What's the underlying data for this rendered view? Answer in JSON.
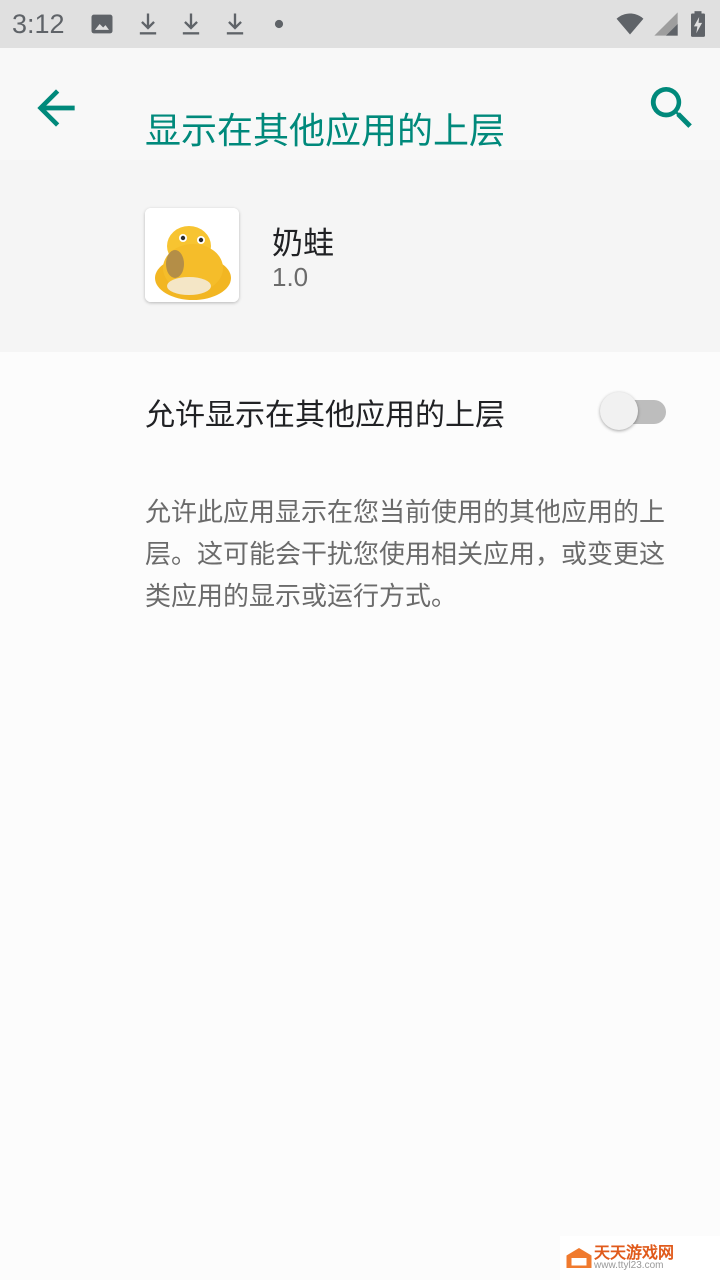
{
  "status_bar": {
    "time": "3:12",
    "icons": [
      "image-icon",
      "download-icon",
      "download-icon",
      "download-icon",
      "dot-icon",
      "wifi-icon",
      "signal-icon",
      "battery-charging-icon"
    ]
  },
  "app_bar": {
    "title": "显示在其他应用的上层",
    "back_icon": "arrow-back-icon",
    "search_icon": "search-icon"
  },
  "app": {
    "name": "奶蛙",
    "version": "1.0"
  },
  "setting": {
    "label": "允许显示在其他应用的上层",
    "enabled": false,
    "summary": "允许此应用显示在您当前使用的其他应用的上层。这可能会干扰您使用相关应用，或变更这类应用的显示或运行方式。"
  },
  "watermark": {
    "text": "天天游戏网",
    "url": "www.ttyl23.com"
  },
  "colors": {
    "accent": "#00897b",
    "status_bar": "#e0e0e0",
    "switch_track_off": "#bdbdbd"
  }
}
